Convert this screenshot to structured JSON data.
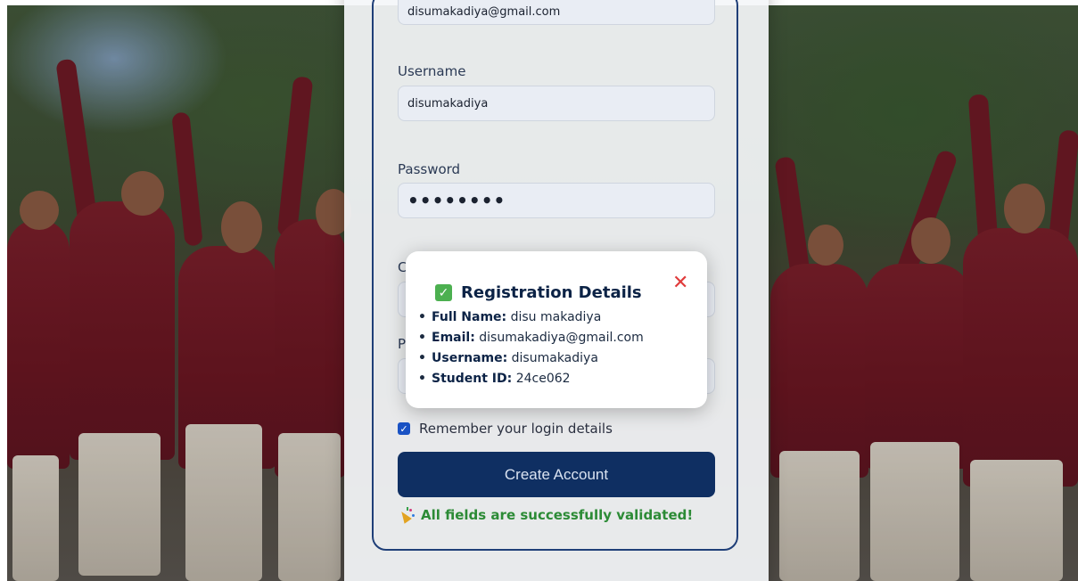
{
  "form": {
    "email_value": "disumakadiya@gmail.com",
    "username_label": "Username",
    "username_value": "disumakadiya",
    "password_label": "Password",
    "password_value": "••••••••",
    "confirm_label_partial": "C",
    "pid_label_partial": "P",
    "remember_label": "Remember your login details",
    "remember_checked": true,
    "create_button_label": "Create Account",
    "success_message": "All fields are successfully validated!"
  },
  "modal": {
    "title": "Registration Details",
    "close_symbol": "✕",
    "rows": [
      {
        "key": "Full Name:",
        "value": "disu makadiya"
      },
      {
        "key": "Email:",
        "value": "disumakadiya@gmail.com"
      },
      {
        "key": "Username:",
        "value": "disumakadiya"
      },
      {
        "key": "Student ID:",
        "value": "24ce062"
      }
    ]
  },
  "icons": {
    "modal_title_icon": "check-box-icon",
    "close": "close-icon",
    "success": "party-popper-icon",
    "checkbox": "checkbox-checked-icon"
  },
  "colors": {
    "accent_navy": "#0f2f62",
    "success_green": "#2c8b36",
    "close_red": "#e03b3b",
    "check_green": "#4cb050"
  }
}
